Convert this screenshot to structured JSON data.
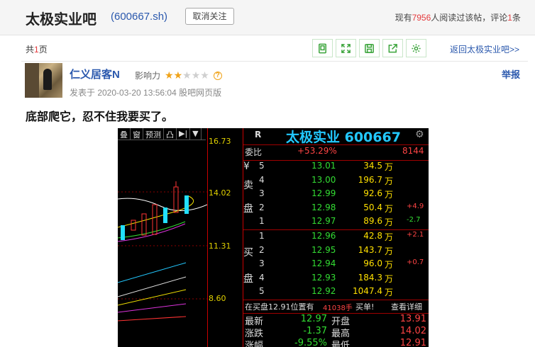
{
  "header": {
    "bar_title": "太极实业吧",
    "stock_code": "(600667.sh)",
    "unfollow_label": "取消关注",
    "stats_prefix": "现有",
    "readers": "7956",
    "stats_middle": "人阅读过该帖，评论",
    "comments": "1",
    "stats_suffix": "条"
  },
  "pager": {
    "prefix": "共",
    "pages": "1",
    "suffix": "页"
  },
  "toolbar": {
    "icons": [
      "page-icon",
      "expand-icon",
      "save-icon",
      "share-icon",
      "settings-icon"
    ]
  },
  "back_link": "返回太极实业吧>>",
  "post": {
    "author": "仁义居客N",
    "influence_label": "影响力",
    "influence_stars": 2,
    "influence_max": 5,
    "qmark": "?",
    "report_label": "举报",
    "meta": "发表于 2020-03-20 13:56:04 股吧网页版",
    "text": "底部爬它，忍不住我要买了。"
  },
  "stock_image": {
    "menu": [
      "叠",
      "窗",
      "预测",
      "凸",
      "▶|",
      "▼"
    ],
    "axis_labels": [
      "16.73",
      "14.02",
      "11.31",
      "8.60"
    ],
    "panel_r": "R",
    "panel_title": "太极实业 600667",
    "weibi_label": "委比",
    "weibi_value": "+53.29%",
    "weicha_value": "8144",
    "sell_side": [
      "¥",
      "卖",
      "盘"
    ],
    "buy_side": [
      "买",
      "盘"
    ],
    "sell_rows": [
      {
        "level": "5",
        "price": "13.01",
        "volume": "34.5",
        "unit": "万",
        "change": ""
      },
      {
        "level": "4",
        "price": "13.00",
        "volume": "196.7",
        "unit": "万",
        "change": ""
      },
      {
        "level": "3",
        "price": "12.99",
        "volume": "92.6",
        "unit": "万",
        "change": ""
      },
      {
        "level": "2",
        "price": "12.98",
        "volume": "50.4",
        "unit": "万",
        "change": "+4.9"
      },
      {
        "level": "1",
        "price": "12.97",
        "volume": "89.6",
        "unit": "万",
        "change": "-2.7"
      }
    ],
    "buy_rows": [
      {
        "level": "1",
        "price": "12.96",
        "volume": "42.8",
        "unit": "万",
        "change": "+2.1"
      },
      {
        "level": "2",
        "price": "12.95",
        "volume": "143.7",
        "unit": "万",
        "change": ""
      },
      {
        "level": "3",
        "price": "12.94",
        "volume": "96.0",
        "unit": "万",
        "change": "+0.7"
      },
      {
        "level": "4",
        "price": "12.93",
        "volume": "184.3",
        "unit": "万",
        "change": ""
      },
      {
        "level": "5",
        "price": "12.92",
        "volume": "1047.4",
        "unit": "万",
        "change": ""
      }
    ],
    "notice_prefix": "在买盘12.91位置有",
    "notice_amount": "41038手",
    "notice_suffix": "买单!",
    "notice_link": "查看详细",
    "quote_rows": [
      {
        "l1": "最新",
        "v1": "12.97",
        "l2": "开盘",
        "v2": "13.91"
      },
      {
        "l1": "涨跌",
        "v1": "-1.37",
        "l2": "最高",
        "v2": "14.02"
      },
      {
        "l1": "涨幅",
        "v1": "-9.55%",
        "l2": "最低",
        "v2": "12.91"
      }
    ]
  },
  "colors": {
    "link_blue": "#2a58ad",
    "highlight_red": "#e4393c",
    "toolbar_green": "#3aa43a",
    "star_orange": "#f0a319"
  }
}
